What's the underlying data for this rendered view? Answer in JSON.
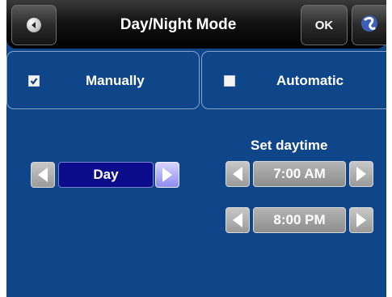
{
  "header": {
    "title": "Day/Night Mode",
    "ok_label": "OK",
    "back_icon": "back-arrow-icon",
    "brand_icon": "brand-logo-icon"
  },
  "modes": [
    {
      "label": "Manually",
      "checked": true
    },
    {
      "label": "Automatic",
      "checked": false
    }
  ],
  "day_selector": {
    "value": "Day"
  },
  "daytime": {
    "label": "Set daytime",
    "start": "7:00 AM",
    "end": "8:00 PM"
  },
  "colors": {
    "background": "#0f4589",
    "titlebar": "#000000",
    "selected_value": "#0a0c8c",
    "active_arrow": "#a9a6f5"
  }
}
